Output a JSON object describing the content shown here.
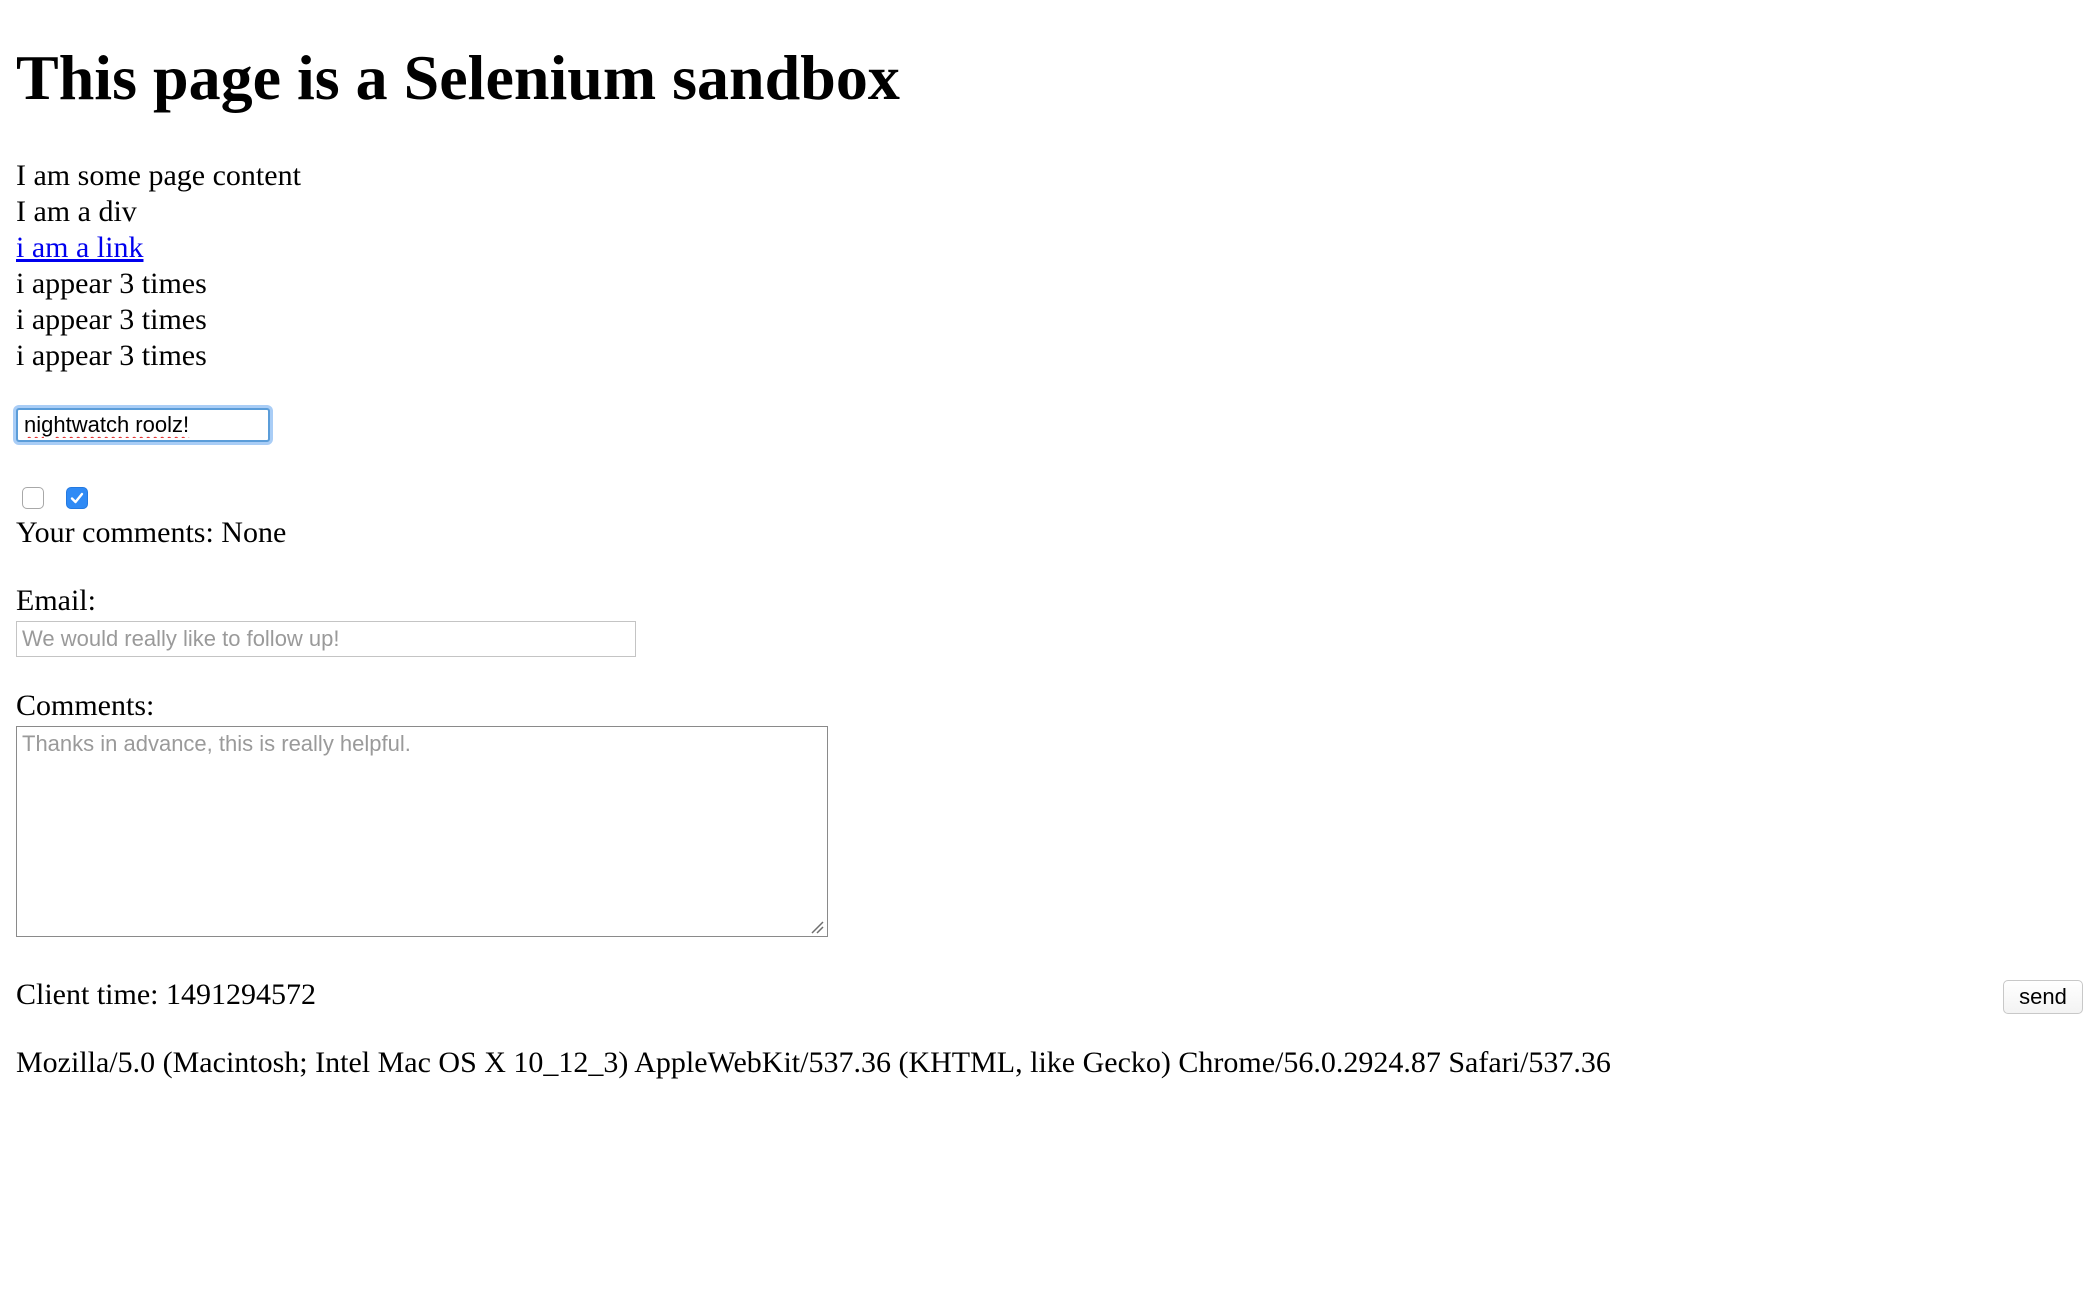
{
  "page": {
    "heading": "This page is a Selenium sandbox",
    "content_text": "I am some page content",
    "div_text": "I am a div",
    "link_text": "i am a link",
    "repeated_text": [
      "i appear 3 times",
      "i appear 3 times",
      "i appear 3 times"
    ]
  },
  "text_input": {
    "value": "nightwatch roolz!"
  },
  "checkboxes": [
    {
      "checked": false
    },
    {
      "checked": true
    }
  ],
  "comments_status": "Your comments: None",
  "email": {
    "label": "Email:",
    "placeholder": "We would really like to follow up!",
    "value": ""
  },
  "comments": {
    "label": "Comments:",
    "placeholder": "Thanks in advance, this is really helpful.",
    "value": ""
  },
  "client_time": "Client time: 1491294572",
  "send_button": {
    "label": "send"
  },
  "user_agent": "Mozilla/5.0 (Macintosh; Intel Mac OS X 10_12_3) AppleWebKit/537.36 (KHTML, like Gecko) Chrome/56.0.2924.87 Safari/537.36",
  "colors": {
    "link": "#0000ee",
    "focus_ring": "#5b9dd9",
    "checkbox_checked": "#2f8af5"
  }
}
